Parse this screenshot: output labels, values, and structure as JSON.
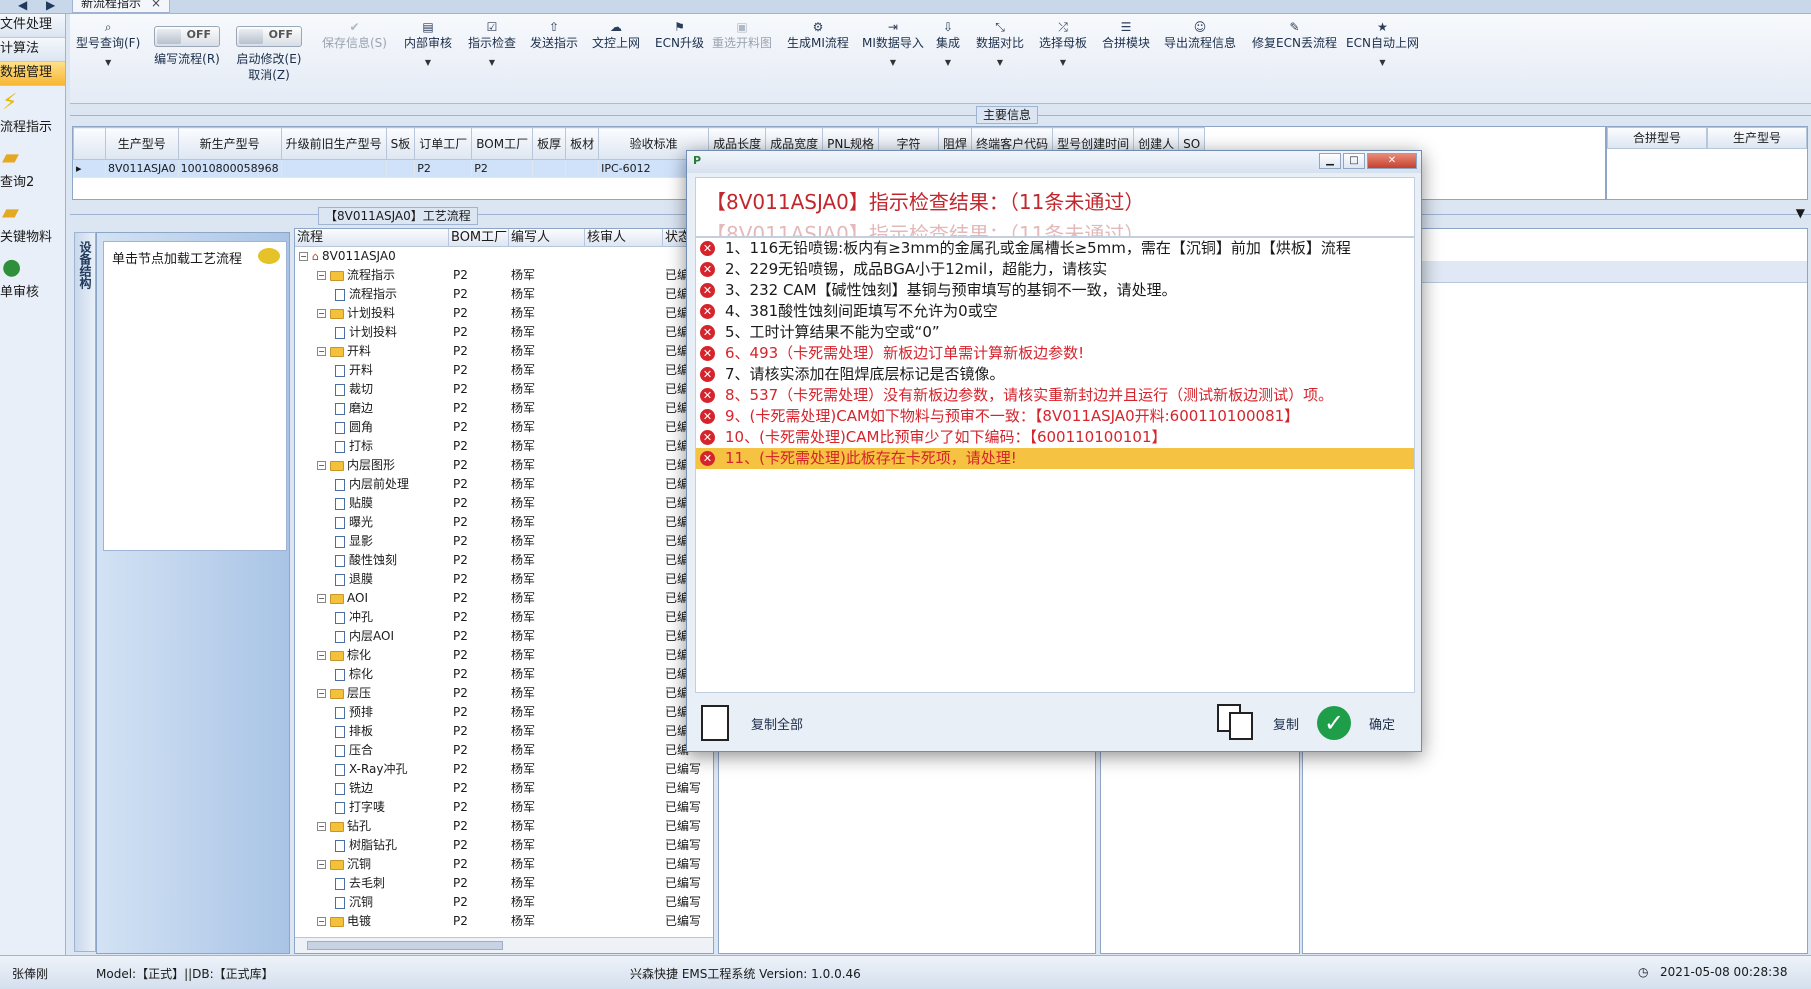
{
  "titlebar": {
    "nav_back": "◀",
    "nav_fwd": "▶",
    "tab_label": "新流程指示",
    "tab_close": "×"
  },
  "leftnav": {
    "items": [
      {
        "label": "文件处理",
        "active": false
      },
      {
        "label": "计算法",
        "active": false
      },
      {
        "label": "数据管理",
        "active": true
      }
    ],
    "icon_items": [
      {
        "label": "流程指示",
        "icon": "lightning-icon"
      },
      {
        "label": "查询2",
        "icon": "folder-icon"
      },
      {
        "label": "关键物料",
        "icon": "folder-icon"
      },
      {
        "label": "单审核",
        "icon": "user-icon"
      }
    ]
  },
  "toolbar": {
    "query_label": "型号查询(F)",
    "write_flow_label": "编写流程(R)",
    "toggle_off": "OFF",
    "start_modify_label": "启动修改(E)",
    "cancel_label": "取消(Z)",
    "buttons": [
      {
        "label": "保存信息(S)",
        "icon": "check-icon",
        "disabled": true
      },
      {
        "label": "内部审核",
        "icon": "printer-icon",
        "disabled": false
      },
      {
        "label": "指示检查",
        "icon": "checkbox-icon",
        "disabled": false
      },
      {
        "label": "发送指示",
        "icon": "upload-icon",
        "disabled": false
      },
      {
        "label": "文控上网",
        "icon": "cloud-upload-icon",
        "disabled": false
      },
      {
        "label": "ECN升级",
        "icon": "ecn-icon",
        "disabled": false
      },
      {
        "label": "重选开料图",
        "icon": "image-icon",
        "disabled": true
      },
      {
        "label": "生成MI流程",
        "icon": "gears-icon",
        "disabled": false
      },
      {
        "label": "MI数据导入",
        "icon": "sign-in-icon",
        "disabled": false
      },
      {
        "label": "集成",
        "icon": "download-icon",
        "disabled": false
      },
      {
        "label": "数据对比",
        "icon": "compress-icon",
        "disabled": false
      },
      {
        "label": "选择母板",
        "icon": "shuffle-icon",
        "disabled": false
      },
      {
        "label": "合拼模块",
        "icon": "list-icon",
        "disabled": false
      },
      {
        "label": "导出流程信息",
        "icon": "smile-icon",
        "disabled": false
      },
      {
        "label": "修复ECN丢流程",
        "icon": "wrench-icon",
        "disabled": false
      },
      {
        "label": "ECN自动上网",
        "icon": "star-icon",
        "disabled": false
      }
    ]
  },
  "maininfo": {
    "label": "主要信息"
  },
  "main_grid": {
    "headers": [
      "生产型号",
      "新生产型号",
      "升级前旧生产型号",
      "S板",
      "订单工厂",
      "BOM工厂",
      "板厚",
      "板材",
      "验收标准",
      "成品长度",
      "成品宽度",
      "PNL规格",
      "字符",
      "阻焊",
      "终端客户代码",
      "型号创建时间",
      "创建人",
      "SO"
    ],
    "row": [
      "8V011ASJA0",
      "10010800058968",
      "",
      "",
      "P2",
      "P2",
      "",
      "",
      "IPC-6012",
      "",
      "",
      "",
      "",
      "",
      "",
      "",
      "",
      ""
    ]
  },
  "merge_grid": {
    "headers": [
      "合拼型号",
      "生产型号"
    ]
  },
  "midstrip": {
    "label": "【8V011ASJA0】工艺流程"
  },
  "sidetab": {
    "label": "设备结构"
  },
  "procpanel": {
    "hint": "单击节点加载工艺流程"
  },
  "tree": {
    "headers": [
      "流程",
      "BOM工厂",
      "编写人",
      "核审人",
      "状态"
    ],
    "rows": [
      {
        "name": "8V011ASJA0",
        "level": 0,
        "type": "root",
        "bom": "",
        "writer": "",
        "status": ""
      },
      {
        "name": "流程指示",
        "level": 1,
        "type": "folder",
        "bom": "P2",
        "writer": "杨军",
        "status": "已编"
      },
      {
        "name": "流程指示",
        "level": 2,
        "type": "page",
        "bom": "P2",
        "writer": "杨军",
        "status": "已编"
      },
      {
        "name": "计划投料",
        "level": 1,
        "type": "folder",
        "bom": "P2",
        "writer": "杨军",
        "status": "已编"
      },
      {
        "name": "计划投料",
        "level": 2,
        "type": "page",
        "bom": "P2",
        "writer": "杨军",
        "status": "已编"
      },
      {
        "name": "开料",
        "level": 1,
        "type": "folder",
        "bom": "P2",
        "writer": "杨军",
        "status": "已编"
      },
      {
        "name": "开料",
        "level": 2,
        "type": "page",
        "bom": "P2",
        "writer": "杨军",
        "status": "已编"
      },
      {
        "name": "裁切",
        "level": 2,
        "type": "page",
        "bom": "P2",
        "writer": "杨军",
        "status": "已编"
      },
      {
        "name": "磨边",
        "level": 2,
        "type": "page",
        "bom": "P2",
        "writer": "杨军",
        "status": "已编"
      },
      {
        "name": "圆角",
        "level": 2,
        "type": "page",
        "bom": "P2",
        "writer": "杨军",
        "status": "已编"
      },
      {
        "name": "打标",
        "level": 2,
        "type": "page",
        "bom": "P2",
        "writer": "杨军",
        "status": "已编"
      },
      {
        "name": "内层图形",
        "level": 1,
        "type": "folder",
        "bom": "P2",
        "writer": "杨军",
        "status": "已编"
      },
      {
        "name": "内层前处理",
        "level": 2,
        "type": "page",
        "bom": "P2",
        "writer": "杨军",
        "status": "已编"
      },
      {
        "name": "贴膜",
        "level": 2,
        "type": "page",
        "bom": "P2",
        "writer": "杨军",
        "status": "已编"
      },
      {
        "name": "曝光",
        "level": 2,
        "type": "page",
        "bom": "P2",
        "writer": "杨军",
        "status": "已编"
      },
      {
        "name": "显影",
        "level": 2,
        "type": "page",
        "bom": "P2",
        "writer": "杨军",
        "status": "已编"
      },
      {
        "name": "酸性蚀刻",
        "level": 2,
        "type": "page",
        "bom": "P2",
        "writer": "杨军",
        "status": "已编"
      },
      {
        "name": "退膜",
        "level": 2,
        "type": "page",
        "bom": "P2",
        "writer": "杨军",
        "status": "已编"
      },
      {
        "name": "AOI",
        "level": 1,
        "type": "folder",
        "bom": "P2",
        "writer": "杨军",
        "status": "已编"
      },
      {
        "name": "冲孔",
        "level": 2,
        "type": "page",
        "bom": "P2",
        "writer": "杨军",
        "status": "已编"
      },
      {
        "name": "内层AOI",
        "level": 2,
        "type": "page",
        "bom": "P2",
        "writer": "杨军",
        "status": "已编"
      },
      {
        "name": "棕化",
        "level": 1,
        "type": "folder",
        "bom": "P2",
        "writer": "杨军",
        "status": "已编"
      },
      {
        "name": "棕化",
        "level": 2,
        "type": "page",
        "bom": "P2",
        "writer": "杨军",
        "status": "已编"
      },
      {
        "name": "层压",
        "level": 1,
        "type": "folder",
        "bom": "P2",
        "writer": "杨军",
        "status": "已编"
      },
      {
        "name": "预排",
        "level": 2,
        "type": "page",
        "bom": "P2",
        "writer": "杨军",
        "status": "已编"
      },
      {
        "name": "排板",
        "level": 2,
        "type": "page",
        "bom": "P2",
        "writer": "杨军",
        "status": "已编"
      },
      {
        "name": "压合",
        "level": 2,
        "type": "page",
        "bom": "P2",
        "writer": "杨军",
        "status": "已编"
      },
      {
        "name": "X-Ray冲孔",
        "level": 2,
        "type": "page",
        "bom": "P2",
        "writer": "杨军",
        "status": "已编写"
      },
      {
        "name": "铣边",
        "level": 2,
        "type": "page",
        "bom": "P2",
        "writer": "杨军",
        "status": "已编写"
      },
      {
        "name": "打字唛",
        "level": 2,
        "type": "page",
        "bom": "P2",
        "writer": "杨军",
        "status": "已编写"
      },
      {
        "name": "钻孔",
        "level": 1,
        "type": "folder",
        "bom": "P2",
        "writer": "杨军",
        "status": "已编写"
      },
      {
        "name": "树脂钻孔",
        "level": 2,
        "type": "page",
        "bom": "P2",
        "writer": "杨军",
        "status": "已编写"
      },
      {
        "name": "沉铜",
        "level": 1,
        "type": "folder",
        "bom": "P2",
        "writer": "杨军",
        "status": "已编写"
      },
      {
        "name": "去毛刺",
        "level": 2,
        "type": "page",
        "bom": "P2",
        "writer": "杨军",
        "status": "已编写"
      },
      {
        "name": "沉铜",
        "level": 2,
        "type": "page",
        "bom": "P2",
        "writer": "杨军",
        "status": "已编写"
      },
      {
        "name": "电镀",
        "level": 1,
        "type": "folder",
        "bom": "P2",
        "writer": "杨军",
        "status": "已编写"
      }
    ]
  },
  "dialog": {
    "app_icon": "P",
    "title": "【8V011ASJA0】指示检查结果：（11条未通过）",
    "subtitle_ghost": "【8V011ASJA0】指示检查结果：（11条未通过）",
    "items": [
      {
        "text": "1、116无铅喷锡:板内有≥3mm的金属孔或金属槽长≥5mm，需在【沉铜】前加【烘板】流程",
        "color": "black",
        "highlight": false
      },
      {
        "text": "2、229无铅喷锡，成品BGA小于12mil，超能力，请核实",
        "color": "black",
        "highlight": false
      },
      {
        "text": "3、232 CAM【碱性蚀刻】基铜与预审填写的基铜不一致，请处理。",
        "color": "black",
        "highlight": false
      },
      {
        "text": "4、381酸性蚀刻间距填写不允许为0或空",
        "color": "black",
        "highlight": false
      },
      {
        "text": "5、工时计算结果不能为空或“0”",
        "color": "black",
        "highlight": false
      },
      {
        "text": "6、493（卡死需处理）新板边订单需计算新板边参数!",
        "color": "red",
        "highlight": false
      },
      {
        "text": "7、请核实添加在阻焊底层标记是否镜像。",
        "color": "black",
        "highlight": false
      },
      {
        "text": "8、537（卡死需处理）没有新板边参数，请核实重新封边并且运行（测试新板边测试）项。",
        "color": "red",
        "highlight": false
      },
      {
        "text": "9、(卡死需处理)CAM如下物料与预审不一致：【8V011ASJA0开料:600110100081】",
        "color": "red",
        "highlight": false
      },
      {
        "text": "10、(卡死需处理)CAM比预审少了如下编码：【600110100101】",
        "color": "red",
        "highlight": false
      },
      {
        "text": "11、(卡死需处理)此板存在卡死项，请处理!",
        "color": "red",
        "highlight": true
      }
    ],
    "copy_all_label": "复制全部",
    "copy_label": "复制",
    "ok_label": "确定"
  },
  "statusbar": {
    "user": "张俸刚",
    "model_db": "Model:【正式】||DB:【正式库】",
    "app_version": "兴森快捷 EMS工程系统 Version: 1.0.0.46",
    "datetime": "2021-05-08 00:28:38"
  }
}
